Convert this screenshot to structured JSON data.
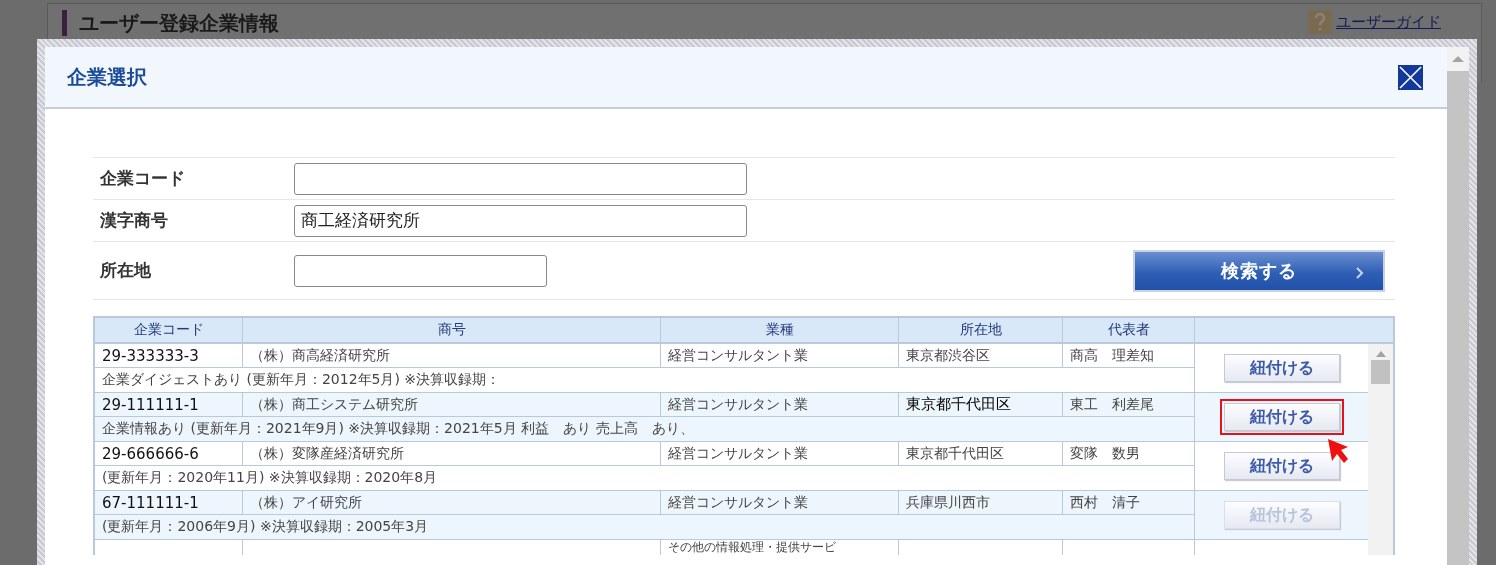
{
  "background_page": {
    "title": "ユーザー登録企業情報",
    "guide_link": "ユーザーガイド"
  },
  "dialog": {
    "title": "企業選択",
    "form": {
      "fields": [
        {
          "label": "企業コード",
          "wide": true
        },
        {
          "label": "漢字商号",
          "value": "商工経済研究所",
          "wide": true
        },
        {
          "label": "所在地",
          "wide": false
        }
      ],
      "search_button": "検索する"
    },
    "table": {
      "columns": [
        "企業コード",
        "商号",
        "業種",
        "所在地",
        "代表者"
      ],
      "rows": [
        {
          "code": "29-333333-3",
          "name": "（株）商高経済研究所",
          "industry": "経営コンサルタント業",
          "location": "東京都渋谷区",
          "location_emphasized": false,
          "representative": "商高　理差知",
          "detail": "企業ダイジェストあり (更新年月：2012年5月) ※決算収録期：",
          "button": {
            "label": "紐付ける",
            "disabled": false,
            "highlighted": false
          }
        },
        {
          "code": "29-111111-1",
          "name": "（株）商工システム研究所",
          "industry": "経営コンサルタント業",
          "location": "東京都千代田区",
          "location_emphasized": true,
          "representative": "東工　利差尾",
          "detail": "企業情報あり (更新年月：2021年9月) ※決算収録期：2021年5月 利益　あり 売上高　あり、",
          "button": {
            "label": "紐付ける",
            "disabled": false,
            "highlighted": true
          }
        },
        {
          "code": "29-666666-6",
          "name": "（株）変隊産経済研究所",
          "industry": "経営コンサルタント業",
          "location": "東京都千代田区",
          "location_emphasized": false,
          "representative": "変隊　数男",
          "detail": "(更新年月：2020年11月) ※決算収録期：2020年8月",
          "button": {
            "label": "紐付ける",
            "disabled": false,
            "highlighted": false
          }
        },
        {
          "code": "67-111111-1",
          "name": "（株）アイ研究所",
          "industry": "経営コンサルタント業",
          "location": "兵庫県川西市",
          "location_emphasized": false,
          "representative": "西村　清子",
          "detail": "(更新年月：2006年9月) ※決算収録期：2005年3月",
          "button": {
            "label": "紐付ける",
            "disabled": true,
            "highlighted": false
          }
        }
      ],
      "partial_row": {
        "industry": "その他の情報処理・提供サービ"
      }
    }
  }
}
